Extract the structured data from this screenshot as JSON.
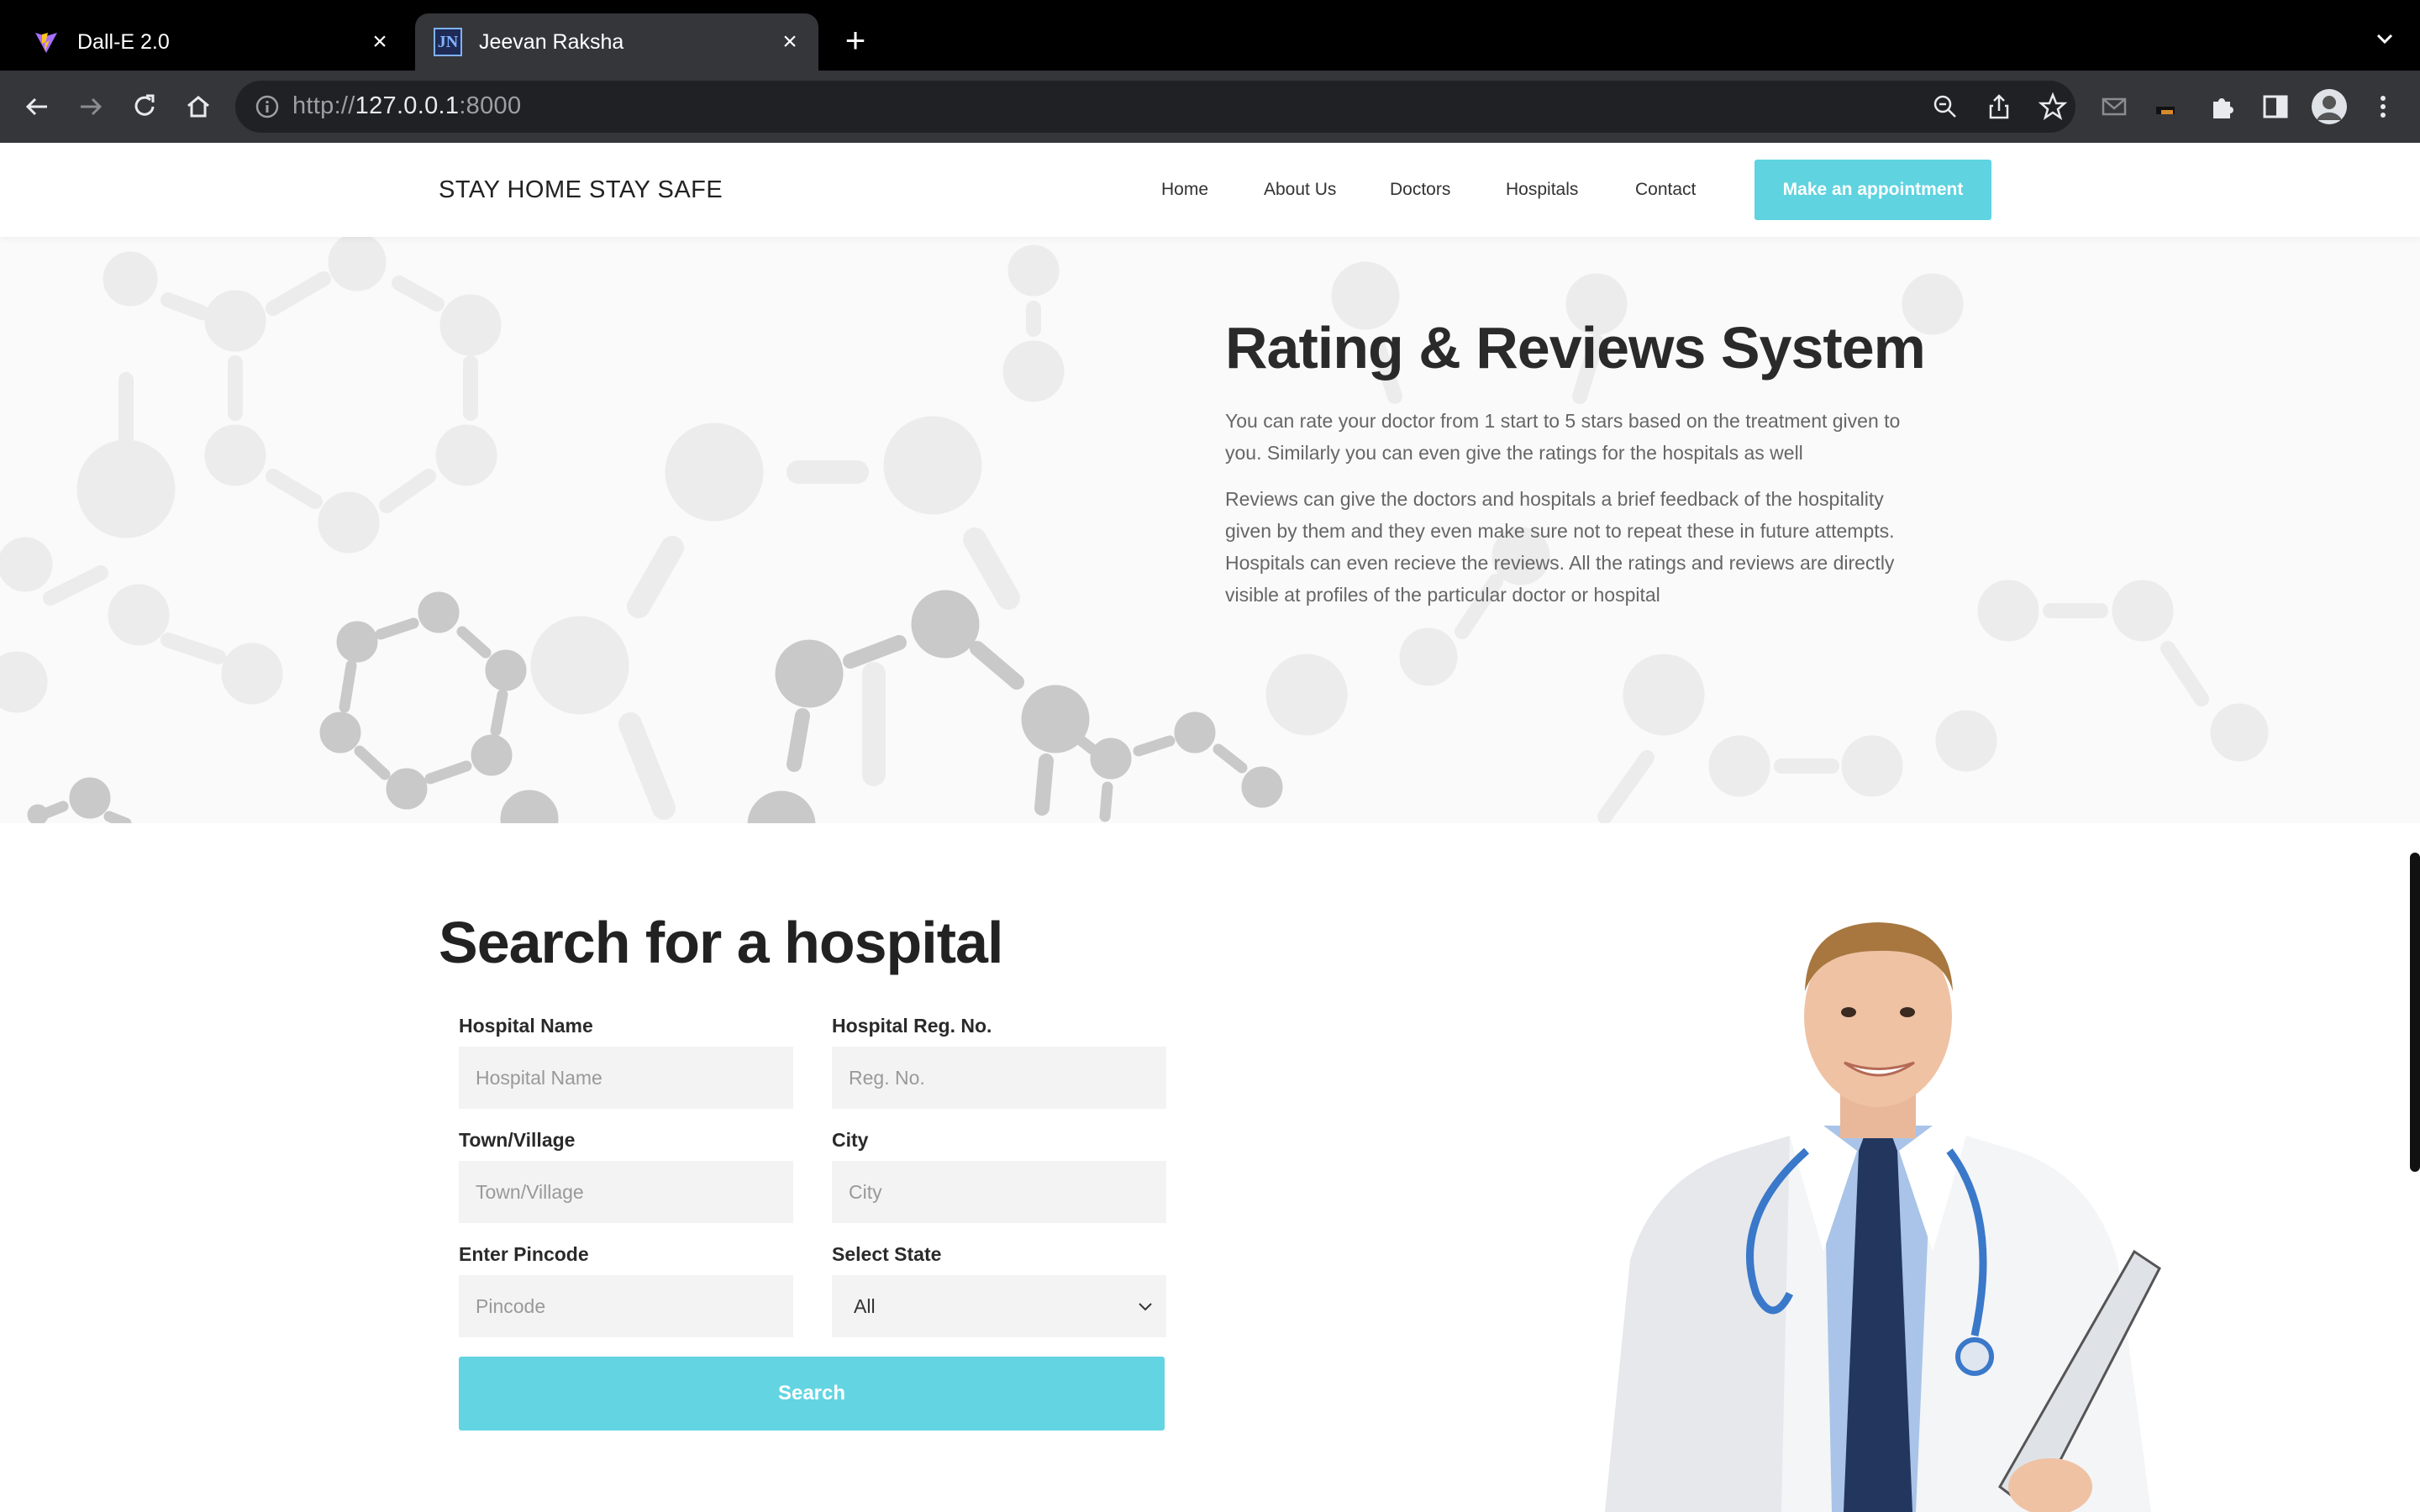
{
  "browser": {
    "tabs": [
      {
        "title": "Dall-E 2.0",
        "favicon": "vite-logo-icon",
        "active": false
      },
      {
        "title": "Jeevan Raksha",
        "favicon": "jn-logo-icon",
        "active": true
      }
    ],
    "url": {
      "scheme": "http://",
      "host": "127.0.0.1",
      "port": ":8000"
    }
  },
  "nav": {
    "brand": "STAY HOME STAY SAFE",
    "links": [
      "Home",
      "About Us",
      "Doctors",
      "Hospitals",
      "Contact"
    ],
    "cta": "Make an appointment"
  },
  "rating": {
    "title": "Rating & Reviews System",
    "p1_line1": "You can rate your doctor from 1 start to 5 stars based on the treatment given to",
    "p1_line2": "you. Similarly you can even give the ratings for the hospitals as well",
    "p2_line1": "Reviews can give the doctors and hospitals a brief feedback of the hospitality",
    "p2_line2": "given by them and they even make sure not to repeat these in future attempts.",
    "p2_line3": "Hospitals can even recieve the reviews. All the ratings and reviews are directly",
    "p2_line4": "visible at profiles of the particular doctor or hospital"
  },
  "search": {
    "title": "Search for a hospital",
    "hospital_name": {
      "label": "Hospital Name",
      "placeholder": "Hospital Name"
    },
    "reg_no": {
      "label": "Hospital Reg. No.",
      "placeholder": "Reg. No."
    },
    "town": {
      "label": "Town/Village",
      "placeholder": "Town/Village"
    },
    "city": {
      "label": "City",
      "placeholder": "City"
    },
    "pincode": {
      "label": "Enter Pincode",
      "placeholder": "Pincode"
    },
    "state": {
      "label": "Select State",
      "value": "All"
    },
    "button": "Search"
  },
  "colors": {
    "accent": "#5fd3e0",
    "chrome_dark": "#35363a"
  }
}
